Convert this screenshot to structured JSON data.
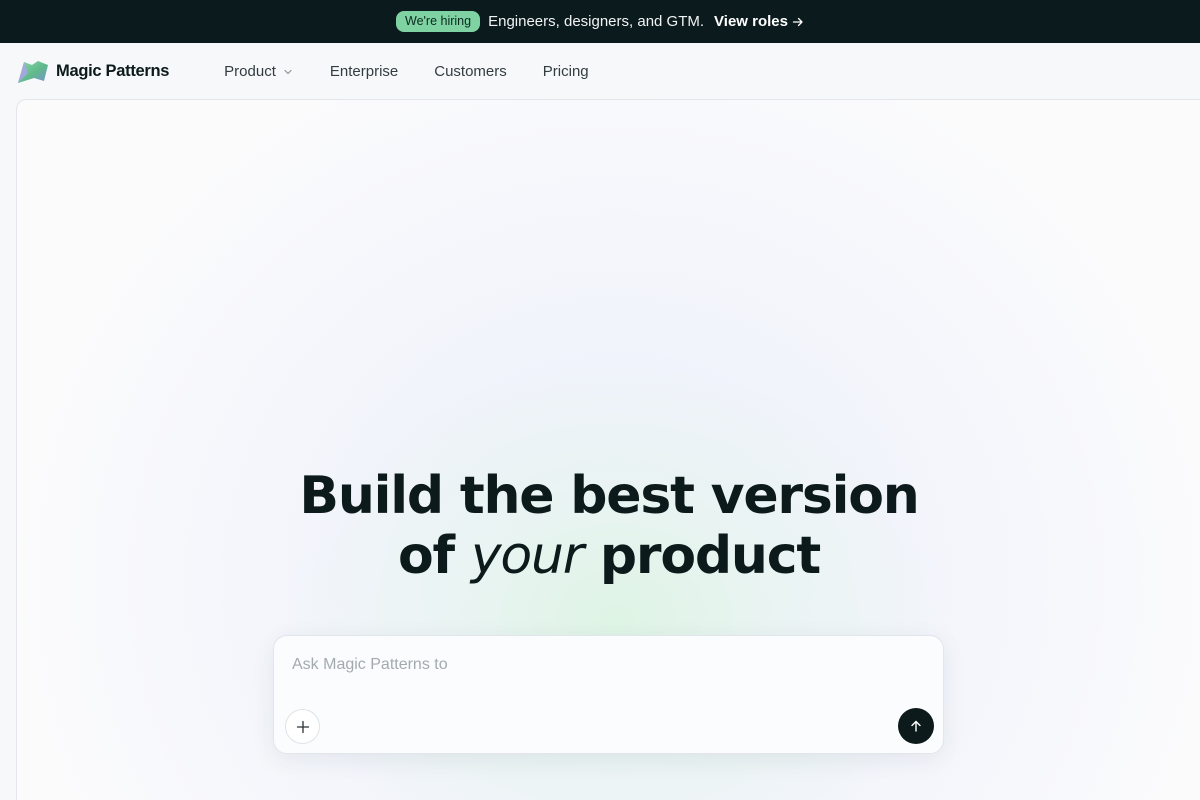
{
  "banner": {
    "badge": "We're hiring",
    "text": "Engineers, designers, and GTM.",
    "link": "View roles",
    "link_icon": "arrow-right-icon"
  },
  "nav": {
    "brand": "Magic Patterns",
    "items": [
      {
        "label": "Product",
        "has_dropdown": true
      },
      {
        "label": "Enterprise"
      },
      {
        "label": "Customers"
      },
      {
        "label": "Pricing"
      }
    ]
  },
  "hero": {
    "headline_line1": "Build the best version",
    "headline_line2_prefix": "of",
    "headline_line2_emphasis": "your",
    "headline_line2_suffix": "product"
  },
  "prompt": {
    "placeholder": "Ask Magic Patterns to",
    "value": "",
    "add_icon": "plus-icon",
    "send_icon": "arrow-up-icon"
  },
  "colors": {
    "banner_bg": "#0b1a1d",
    "badge_bg": "#7fd3a3",
    "send_button": "#0d1a1b"
  }
}
